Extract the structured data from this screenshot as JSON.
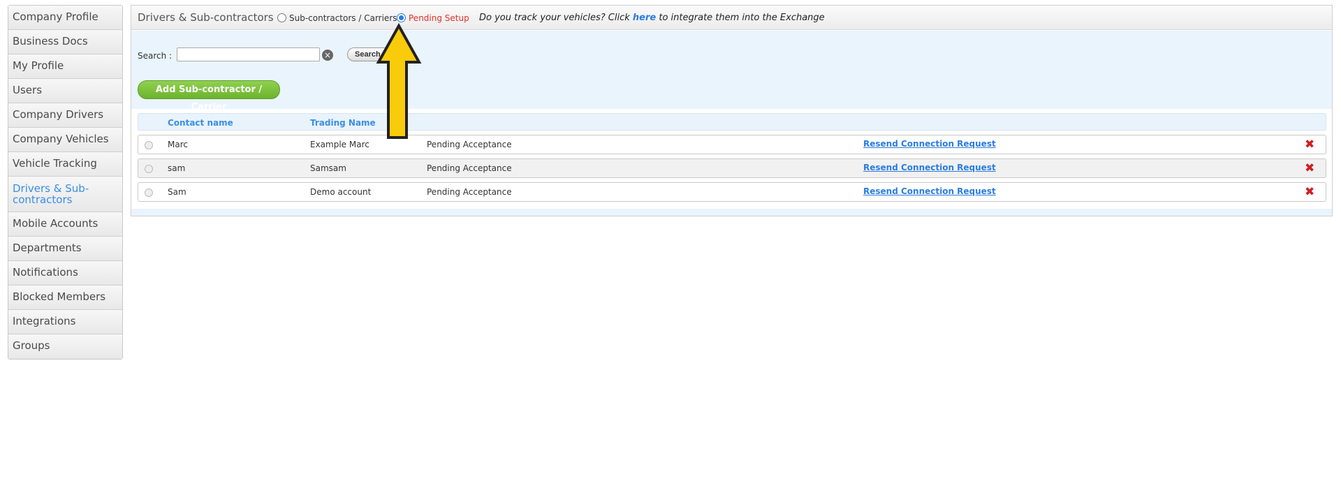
{
  "sidebar": {
    "items": [
      {
        "label": "Company Profile"
      },
      {
        "label": "Business Docs"
      },
      {
        "label": "My Profile"
      },
      {
        "label": "Users"
      },
      {
        "label": "Company Drivers"
      },
      {
        "label": "Company Vehicles"
      },
      {
        "label": "Vehicle Tracking"
      },
      {
        "label": "Drivers & Sub-contractors"
      },
      {
        "label": "Mobile Accounts"
      },
      {
        "label": "Departments"
      },
      {
        "label": "Notifications"
      },
      {
        "label": "Blocked Members"
      },
      {
        "label": "Integrations"
      },
      {
        "label": "Groups"
      }
    ],
    "active_index": 7,
    "active_color": "#3a8ee6"
  },
  "header": {
    "title": "Drivers & Sub-contractors",
    "radio_subcontractors": "Sub-contractors / Carriers",
    "radio_pending": "Pending Setup",
    "selected_radio": "pending",
    "track_prefix": "Do you track your vehicles? Click",
    "track_link": "here",
    "track_suffix": "to integrate them into the Exchange"
  },
  "search": {
    "label": "Search :",
    "value": "",
    "button": "Search"
  },
  "add_button": "Add Sub-contractor / Carrier",
  "table": {
    "columns": {
      "contact": "Contact name",
      "trading": "Trading Name"
    },
    "rows": [
      {
        "contact": "Marc",
        "trading": "Example Marc",
        "status": "Pending Acceptance",
        "action": "Resend Connection Request"
      },
      {
        "contact": "sam",
        "trading": "Samsam",
        "status": "Pending Acceptance",
        "action": "Resend Connection Request"
      },
      {
        "contact": "Sam",
        "trading": "Demo account",
        "status": "Pending Acceptance",
        "action": "Resend Connection Request"
      }
    ]
  },
  "colors": {
    "accent": "#2b7de0",
    "pending": "#e0322b",
    "add_button": "#7cc23b",
    "arrow": "#f9cc0b"
  },
  "icons": {
    "clear": "clear-circle-icon",
    "delete": "red-x-icon",
    "arrow": "up-arrow-annotation-icon"
  }
}
